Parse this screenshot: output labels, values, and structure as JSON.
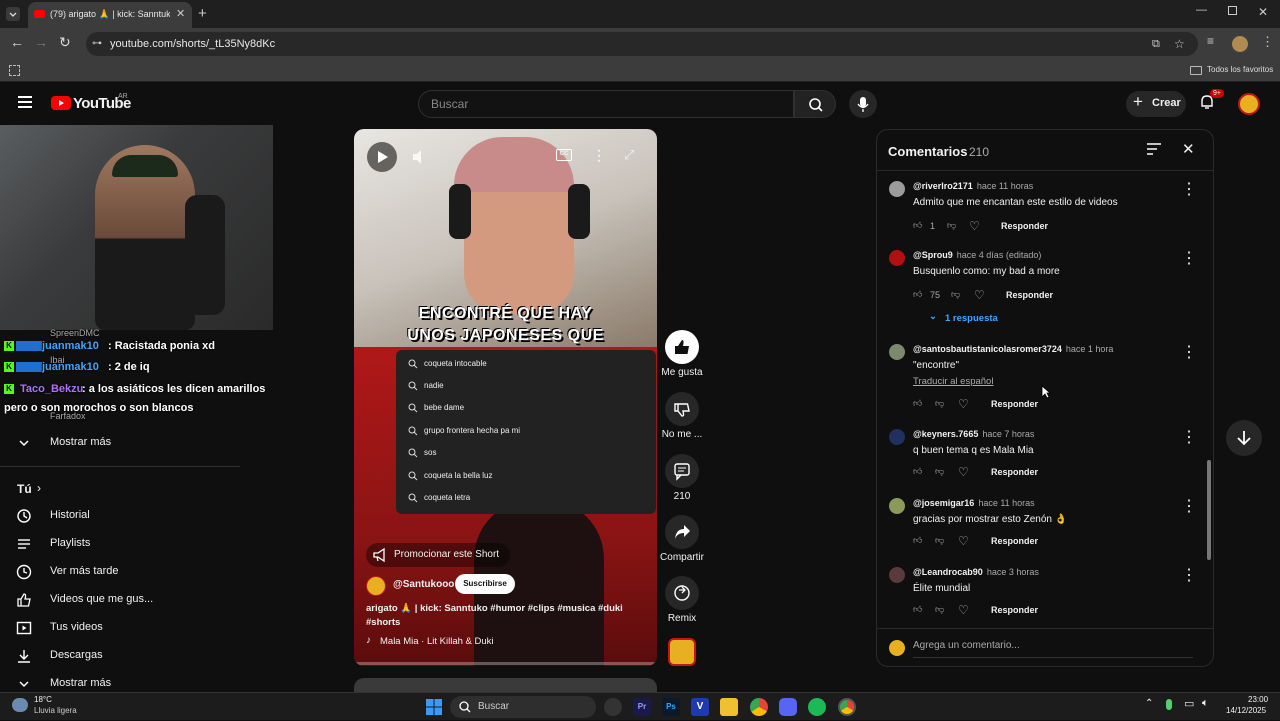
{
  "browser": {
    "tab_title": "(79) arigato 🙏 | kick: Sanntuko #…",
    "url": "youtube.com/shorts/_tL35Ny8dKc",
    "bookmarks_label": "Todos los favoritos"
  },
  "header": {
    "logo_text": "YouTube",
    "region": "AR",
    "search_placeholder": "Buscar",
    "create_label": "Crear",
    "notif_count": "9+"
  },
  "overlay_chat": {
    "messages": [
      {
        "user": "juanmak10",
        "text": ": Racistada ponia xd"
      },
      {
        "user": "juanmak10",
        "text": ": 2 de iq"
      },
      {
        "user": "Taco_Bekzu",
        "text": ": a los asiáticos les dicen amarillos"
      },
      {
        "user": "",
        "text": "pero o son morochos o son blancos"
      }
    ],
    "faded_names": [
      "SpreenDMC",
      "Ibai",
      "Farfadox"
    ]
  },
  "sidebar": {
    "show_more_1": "Mostrar más",
    "you_label": "Tú",
    "items": [
      {
        "label": "Historial",
        "icon": "history-icon"
      },
      {
        "label": "Playlists",
        "icon": "playlists-icon"
      },
      {
        "label": "Ver más tarde",
        "icon": "clock-icon"
      },
      {
        "label": "Videos que me gus...",
        "icon": "thumb-up-icon"
      },
      {
        "label": "Tus videos",
        "icon": "video-icon"
      },
      {
        "label": "Descargas",
        "icon": "download-icon"
      }
    ],
    "show_more_2": "Mostrar más"
  },
  "video": {
    "caption_line1": "ENCONTRÉ QUE HAY",
    "caption_line2": "UNOS JAPONESES QUE",
    "promote_label": "Promocionar este Short",
    "channel": "@Santukooo",
    "subscribe_label": "Suscribirse",
    "description": "arigato 🙏 | kick: Sanntuko #humor #clips #musica #duki",
    "description_2": "#shorts",
    "music": "Mala Mia · Lit Killah & Duki",
    "search_suggestions": [
      "coqueta intocable",
      "nadie",
      "bebe dame",
      "grupo frontera hecha pa mi",
      "sos",
      "coqueta la bella luz",
      "coqueta letra"
    ]
  },
  "actions": {
    "like_label": "Me gusta",
    "dislike_label": "No me ...",
    "comments_count": "210",
    "share_label": "Compartir",
    "remix_label": "Remix"
  },
  "comments": {
    "title": "Comentarios",
    "count": "210",
    "reply_label": "Responder",
    "replies_label": "1 respuesta",
    "translate_label": "Traducir al español",
    "add_placeholder": "Agrega un comentario...",
    "items": [
      {
        "author": "@riverlro2171",
        "time": "hace 11 horas",
        "text": "Admito que me encantan este estilo de videos",
        "likes": "1",
        "avatar_color": "#9c9c9c"
      },
      {
        "author": "@Sprou9",
        "time": "hace 4 días (editado)",
        "text": "Busquenlo como: my bad a more",
        "likes": "75",
        "avatar_color": "#b01010"
      },
      {
        "author": "@santosbautistanicolasromer3724",
        "time": "hace 1 hora",
        "text": "\"encontre\"",
        "likes": "",
        "avatar_color": "#7a8a6a"
      },
      {
        "author": "@keyners.7665",
        "time": "hace 7 horas",
        "text": "q buen tema q es Mala Mia",
        "likes": "",
        "avatar_color": "#203060"
      },
      {
        "author": "@josemigar16",
        "time": "hace 11 horas",
        "text": "gracias por mostrar esto Zenón 👌",
        "likes": "",
        "avatar_color": "#8a9a5a"
      },
      {
        "author": "@Leandrocab90",
        "time": "hace 3 horas",
        "text": "Élite mundial",
        "likes": "",
        "avatar_color": "#5a3a3a"
      }
    ]
  },
  "taskbar": {
    "temp": "18°C",
    "weather": "Lluvia ligera",
    "search": "Buscar",
    "time": "23:00",
    "date": "14/12/2025"
  },
  "colors": {
    "brand_red": "#ff0000",
    "accent_blue": "#3ea6ff",
    "chat_green": "#53fc18"
  }
}
